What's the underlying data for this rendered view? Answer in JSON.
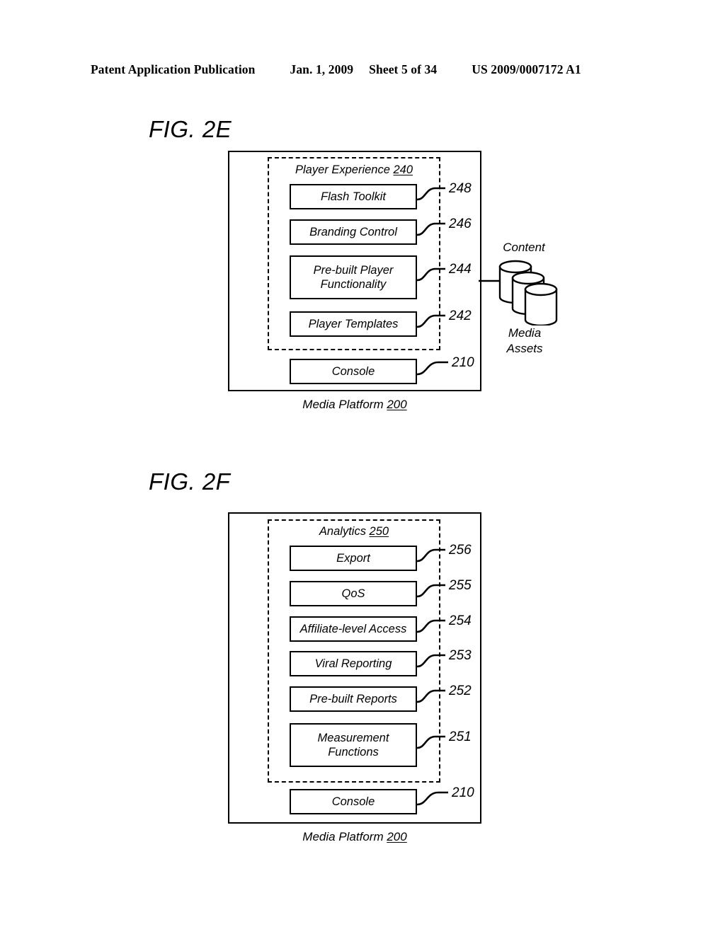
{
  "header": {
    "publication": "Patent Application Publication",
    "date": "Jan. 1, 2009",
    "sheet": "Sheet 5 of 34",
    "patent_number": "US 2009/0007172 A1"
  },
  "figures": [
    {
      "id": "fig-2e",
      "title": "FIG. 2E",
      "group": {
        "label": "Player Experience",
        "ref": "240"
      },
      "modules": [
        {
          "label": "Flash Toolkit",
          "ref": "248"
        },
        {
          "label": "Branding Control",
          "ref": "246"
        },
        {
          "label": "Pre-built Player\nFunctionality",
          "ref": "244"
        },
        {
          "label": "Player Templates",
          "ref": "242"
        }
      ],
      "console": {
        "label": "Console",
        "ref": "210"
      },
      "platform": {
        "label": "Media Platform",
        "ref": "200"
      },
      "datastore": {
        "top_label": "Content",
        "bottom_label": "Media\nAssets",
        "cylinder_count": 3
      }
    },
    {
      "id": "fig-2f",
      "title": "FIG. 2F",
      "group": {
        "label": "Analytics",
        "ref": "250"
      },
      "modules": [
        {
          "label": "Export",
          "ref": "256"
        },
        {
          "label": "QoS",
          "ref": "255"
        },
        {
          "label": "Affiliate-level Access",
          "ref": "254"
        },
        {
          "label": "Viral Reporting",
          "ref": "253"
        },
        {
          "label": "Pre-built Reports",
          "ref": "252"
        },
        {
          "label": "Measurement\nFunctions",
          "ref": "251"
        }
      ],
      "console": {
        "label": "Console",
        "ref": "210"
      },
      "platform": {
        "label": "Media Platform",
        "ref": "200"
      }
    }
  ],
  "colors": {
    "ink": "#000000",
    "paper": "#ffffff"
  }
}
